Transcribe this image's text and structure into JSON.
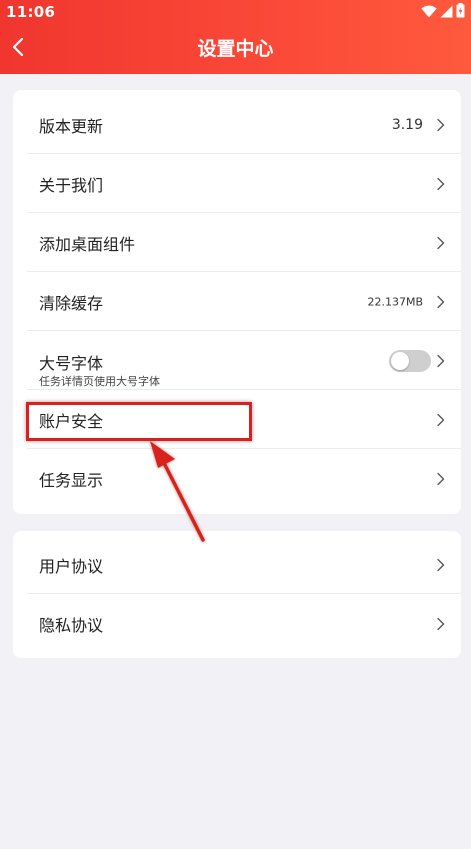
{
  "status_bar": {
    "time": "11:06"
  },
  "header": {
    "title": "设置中心"
  },
  "settings_group_1": [
    {
      "label": "版本更新",
      "value": "3.19"
    },
    {
      "label": "关于我们"
    },
    {
      "label": "添加桌面组件"
    },
    {
      "label": "清除缓存",
      "value": "22.137MB"
    },
    {
      "label": "大号字体",
      "sub": "任务详情页使用大号字体",
      "toggle_on": false
    },
    {
      "label": "账户安全",
      "highlighted": true
    },
    {
      "label": "任务显示"
    }
  ],
  "settings_group_2": [
    {
      "label": "用户协议"
    },
    {
      "label": "隐私协议"
    }
  ],
  "colors": {
    "header_red": "#f0362f",
    "annotation_red": "#d9201e"
  }
}
